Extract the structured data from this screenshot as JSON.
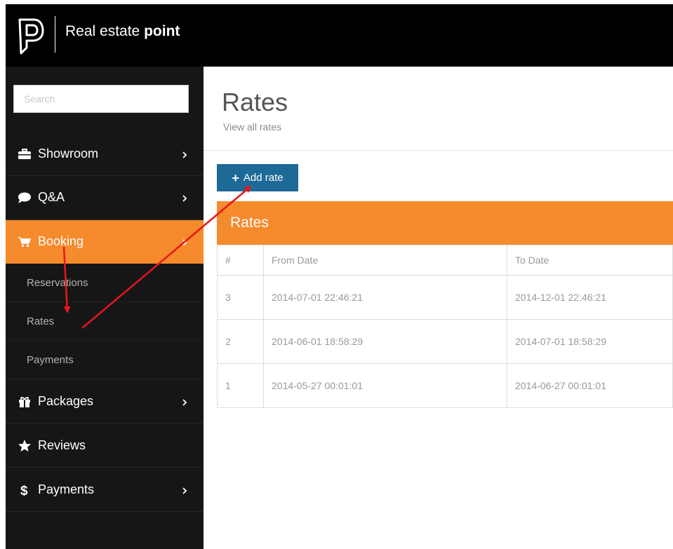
{
  "header": {
    "brand_regular": "Real estate",
    "brand_bold": "point",
    "logo_icon": "logo-p-icon"
  },
  "sidebar": {
    "search_placeholder": "Search",
    "items": [
      {
        "label": "Showroom",
        "icon": "briefcase-icon",
        "chevron": true
      },
      {
        "label": "Q&A",
        "icon": "comment-icon",
        "chevron": true
      },
      {
        "label": "Booking",
        "icon": "cart-icon",
        "chevron": true,
        "active": true
      },
      {
        "label": "Packages",
        "icon": "gift-icon",
        "chevron": true
      },
      {
        "label": "Reviews",
        "icon": "star-icon",
        "chevron": false
      },
      {
        "label": "Payments",
        "icon": "dollar-icon",
        "chevron": true
      }
    ],
    "booking_subitems": [
      {
        "label": "Reservations"
      },
      {
        "label": "Rates"
      },
      {
        "label": "Payments"
      }
    ]
  },
  "main": {
    "title": "Rates",
    "subtitle": "View all rates",
    "add_button_label": "Add rate",
    "panel_title": "Rates",
    "table": {
      "columns": [
        "#",
        "From Date",
        "To Date"
      ],
      "rows": [
        [
          "3",
          "2014-07-01 22:46:21",
          "2014-12-01 22:46:21"
        ],
        [
          "2",
          "2014-06-01 18:58:29",
          "2014-07-01 18:58:29"
        ],
        [
          "1",
          "2014-05-27 00:01:01",
          "2014-06-27 00:01:01"
        ]
      ]
    }
  },
  "colors": {
    "accent_orange": "#f68b2d",
    "button_blue": "#1d6a96",
    "sidebar_bg": "#161616",
    "annotation_red": "#e8161b"
  }
}
